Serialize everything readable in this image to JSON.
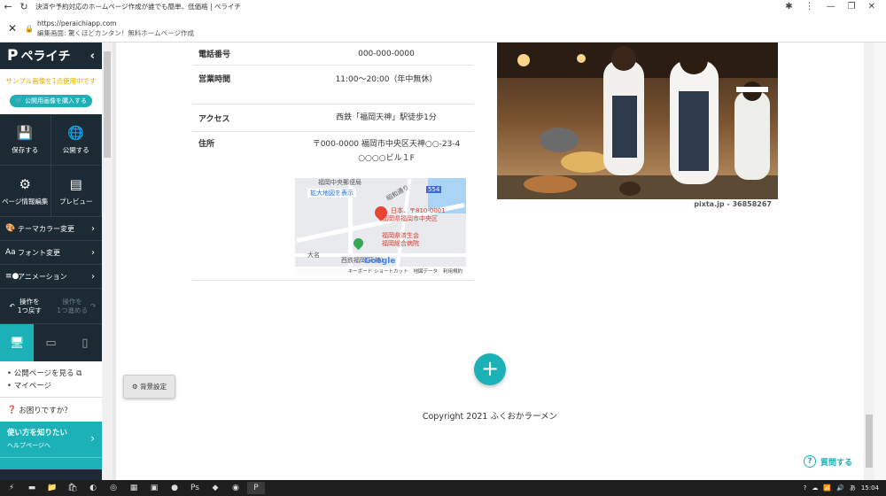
{
  "browser": {
    "tab_title": "決済や予約対応のホームページ作成が誰でも簡単、低価格 | ペライチ",
    "url": "https://peraichiapp.com",
    "subtitle": "編集画面: 驚くほどカンタン！無料ホームページ作成"
  },
  "sidebar": {
    "logo": "ペライチ",
    "sample_notice": "サンプル画像を1点使用中です",
    "buy_button": "公開用画像を購入する",
    "save": "保存する",
    "publish": "公開する",
    "page_info": "ページ情報編集",
    "preview": "プレビュー",
    "theme_color": "テーマカラー変更",
    "font_change": "フォント変更",
    "animation": "アニメーション",
    "undo_line1": "操作を",
    "undo_line2": "1つ戻す",
    "redo_line1": "操作を",
    "redo_line2": "1つ進める",
    "view_public": "公開ページを見る",
    "my_page": "マイページ",
    "help_q": "お困りですか？",
    "howto_title": "使い方を知りたい",
    "howto_sub": "ヘルプページへ"
  },
  "bg_setting": "背景設定",
  "info": {
    "rows": [
      {
        "key": "電話番号",
        "value": "000-000-0000"
      },
      {
        "key": "営業時間",
        "value": "11:00～20:00（年中無休）"
      },
      {
        "key": "アクセス",
        "value": "西鉄「福岡天神」駅徒歩1分"
      },
      {
        "key": "住所",
        "value": "〒000-0000 福岡市中央区天神○○-23-4",
        "value2": "○○○○ビル１F"
      }
    ]
  },
  "map": {
    "enlarge": "拡大地図を表示",
    "label_top": "福岡中央郵便局",
    "label_address": "日本、〒810-0001",
    "label_address2": "福岡県福岡市中央区",
    "label_hospital": "福岡県済生会",
    "label_hospital2": "福岡総合病院",
    "label_station": "西鉄福岡(天神)",
    "label_daimyo": "大名",
    "label_road": "昭和通り",
    "road_num": "554",
    "google": "Google",
    "footer_keyboard": "キーボード ショートカット",
    "footer_data": "地図データ",
    "footer_terms": "利用規約"
  },
  "photo_credit": "pixta.jp - 36858267",
  "copyright": "Copyright 2021 ふくおかラーメン",
  "question_button": "質問する",
  "taskbar": {
    "time": "15:04",
    "ime": "あ"
  }
}
